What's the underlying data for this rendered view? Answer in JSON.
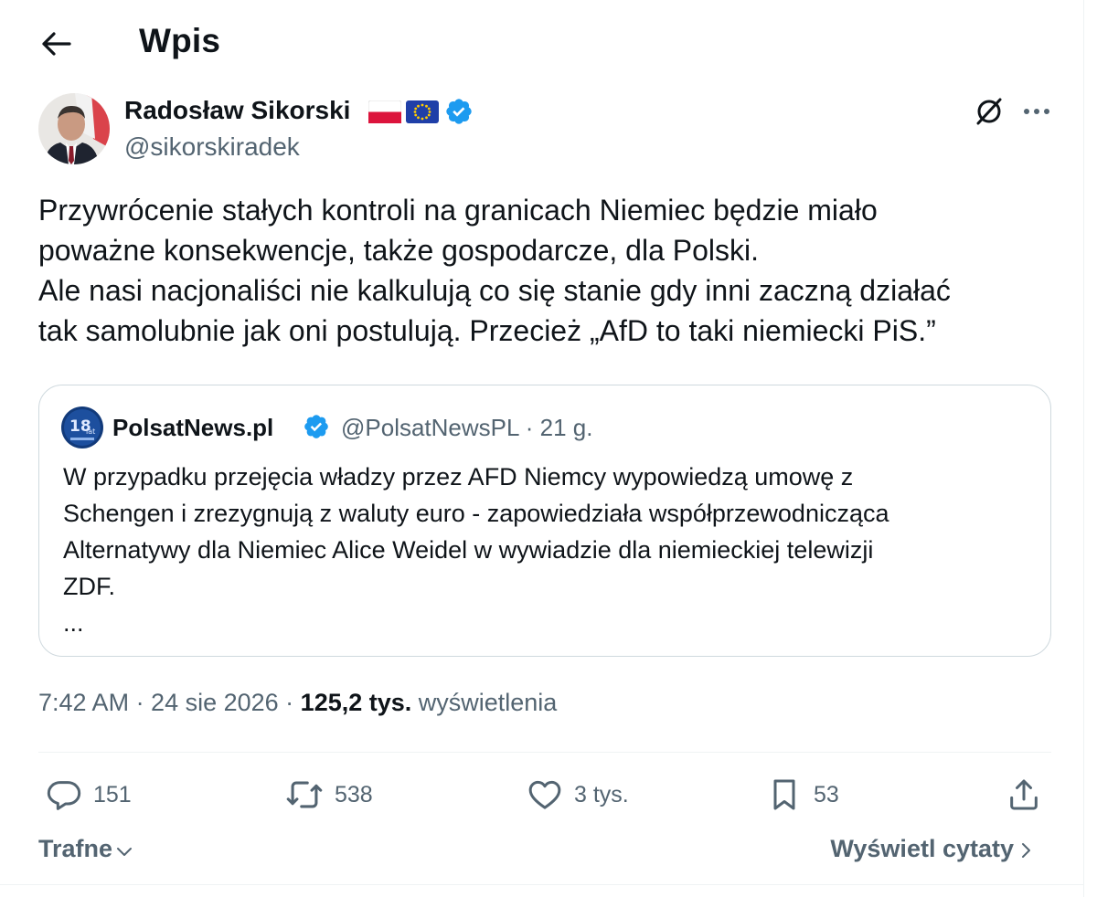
{
  "header": {
    "title": "Wpis"
  },
  "author": {
    "name": "Radosław Sikorski",
    "handle": "@sikorskiradek"
  },
  "tweet": {
    "lines": [
      "Przywrócenie stałych kontroli na granicach Niemiec będzie miało",
      "poważne konsekwencje, także gospodarcze, dla Polski.",
      "Ale nasi nacjonaliści nie kalkulują co się stanie gdy inni zaczną działać",
      "tak samolubnie jak oni postulują. Przecież „AfD to taki niemiecki PiS.”"
    ]
  },
  "quote": {
    "name": "PolsatNews.pl",
    "meta": "@PolsatNewsPL · 21 g.",
    "lines": [
      "W przypadku przejęcia władzy przez AFD Niemcy wypowiedzą umowę z",
      "Schengen i zrezygnują z waluty euro - zapowiedziała współprzewodnicząca",
      "Alternatywy dla Niemiec Alice Weidel w wywiadzie dla niemieckiej telewizji",
      "ZDF.",
      "..."
    ]
  },
  "meta": {
    "time_date": "7:42 AM · 24 sie 2026 · ",
    "views_count": "125,2 tys.",
    "views_label": " wyświetlenia"
  },
  "actions": {
    "replies": "151",
    "reposts": "538",
    "likes": "3 tys.",
    "bookmarks": "53"
  },
  "footer": {
    "sort_label": "Trafne",
    "quotes_label": "Wyświetl cytaty"
  },
  "colors": {
    "text": "#0f1419",
    "secondary": "#536471",
    "verified": "#1d9bf0",
    "border": "#cfd9de"
  }
}
